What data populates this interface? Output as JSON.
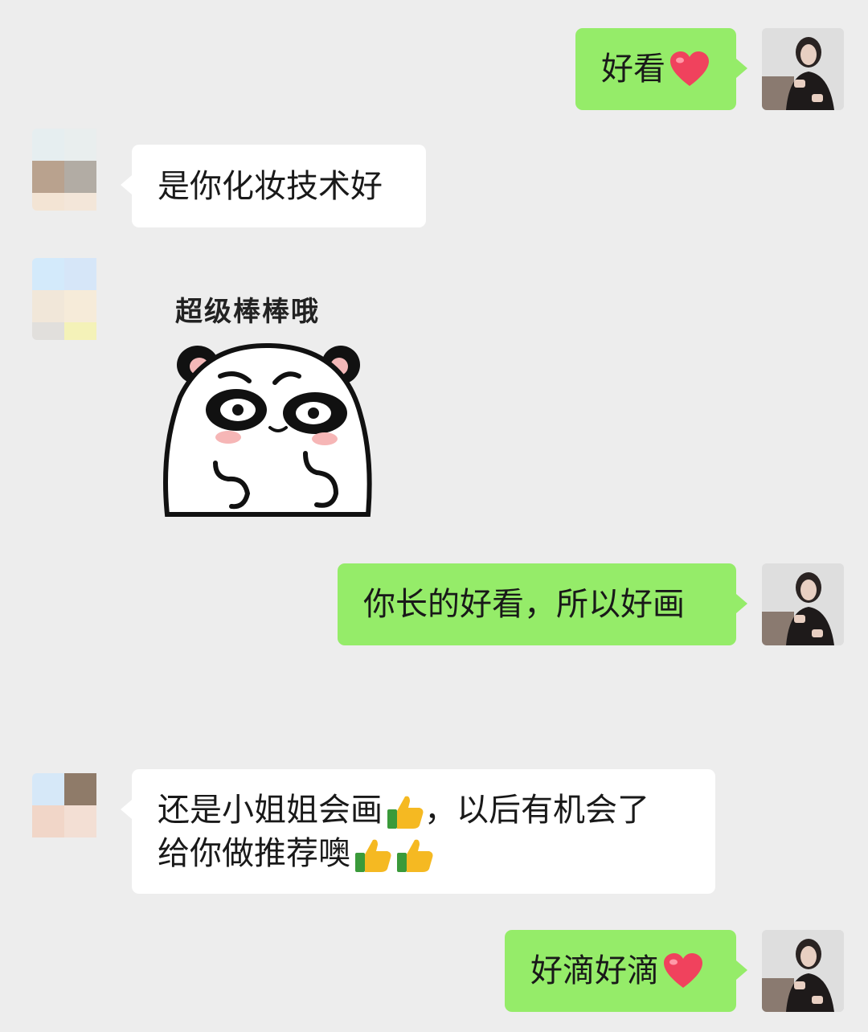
{
  "chat": {
    "messages": [
      {
        "side": "right",
        "text": "好看",
        "emoji": "heart-icon"
      },
      {
        "side": "left",
        "text": "是你化妆技术好"
      },
      {
        "side": "left",
        "type": "sticker",
        "caption": "超级棒棒哦",
        "sticker": "panda-thumbs-up"
      },
      {
        "side": "right",
        "text": "你长的好看，所以好画"
      },
      {
        "side": "left",
        "line1_a": "还是小姐姐会画",
        "line1_b": "，以后有机会了",
        "line2": "给你做推荐噢",
        "emoji": "thumbs-up-icon"
      },
      {
        "side": "right",
        "text": "好滴好滴",
        "emoji": "heart-icon"
      }
    ]
  },
  "colors": {
    "background": "#ededed",
    "self_bubble": "#95ec69",
    "other_bubble": "#ffffff",
    "text": "#191919"
  }
}
